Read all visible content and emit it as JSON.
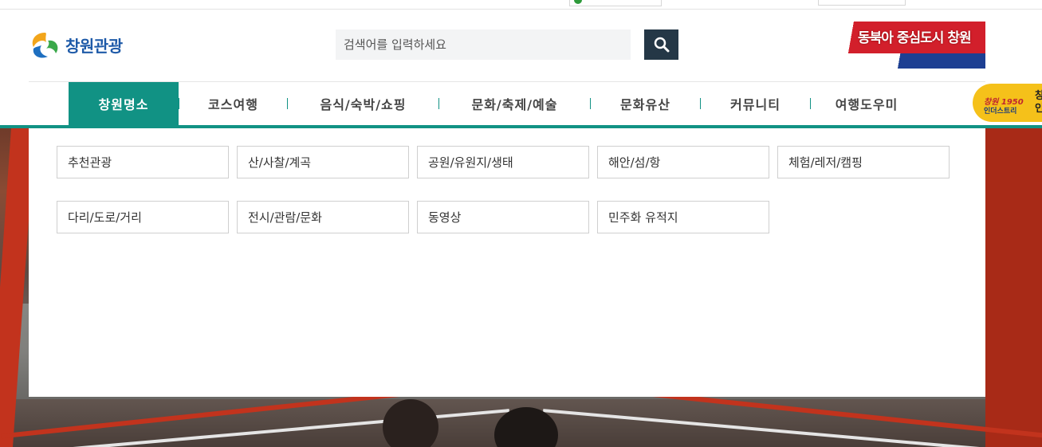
{
  "header": {
    "logo_text": "창원관광",
    "banner_text": "동북아 중심도시 창원"
  },
  "search": {
    "placeholder": "검색어를 입력하세요"
  },
  "nav": {
    "items": [
      {
        "label": "창원명소"
      },
      {
        "label": "코스여행"
      },
      {
        "label": "음식/숙박/쇼핑"
      },
      {
        "label": "문화/축제/예술"
      },
      {
        "label": "문화유산"
      },
      {
        "label": "커뮤니티"
      },
      {
        "label": "여행도우미"
      }
    ],
    "badge": {
      "line1": "창원 1950",
      "line2": "인더스트리",
      "side": "창\n인"
    }
  },
  "submenu": {
    "items": [
      {
        "label": "추천관광"
      },
      {
        "label": "산/사찰/계곡"
      },
      {
        "label": "공원/유원지/생태"
      },
      {
        "label": "해안/섬/항"
      },
      {
        "label": "체험/레저/캠핑"
      },
      {
        "label": "다리/도로/거리"
      },
      {
        "label": "전시/관람/문화"
      },
      {
        "label": "동영상"
      },
      {
        "label": "민주화 유적지"
      }
    ]
  },
  "colors": {
    "accent": "#119284",
    "search_button": "#243746",
    "logo_blue": "#1e5aa8"
  }
}
